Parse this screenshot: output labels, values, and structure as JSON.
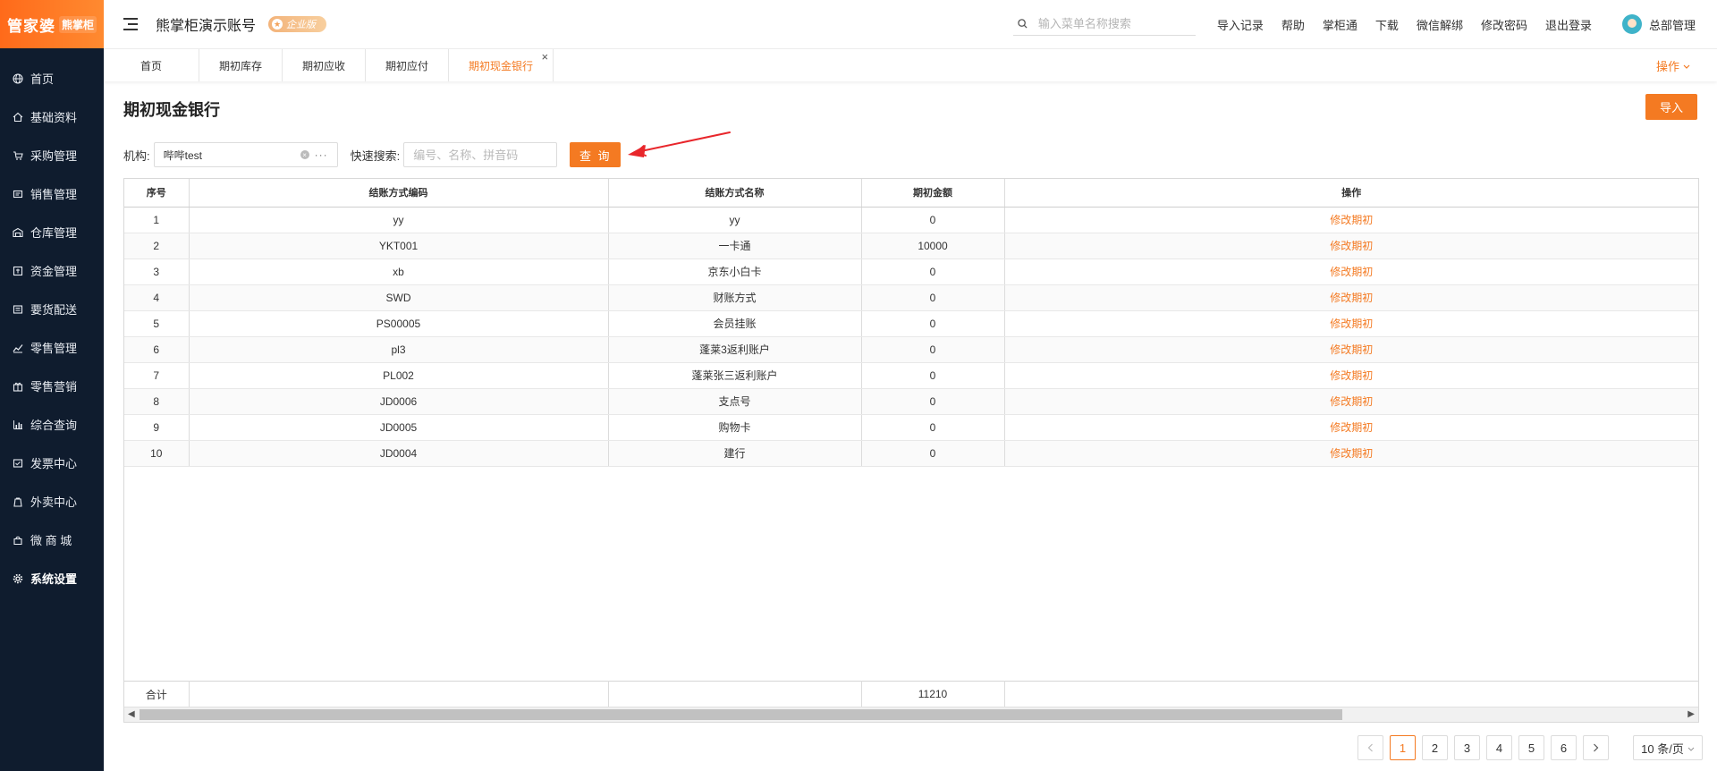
{
  "logo": {
    "brand": "管家婆",
    "product": "熊掌柜"
  },
  "sidebar": {
    "items": [
      {
        "label": "首页",
        "icon": "globe-icon"
      },
      {
        "label": "基础资料",
        "icon": "home-icon"
      },
      {
        "label": "采购管理",
        "icon": "cart-icon"
      },
      {
        "label": "销售管理",
        "icon": "sales-icon"
      },
      {
        "label": "仓库管理",
        "icon": "warehouse-icon"
      },
      {
        "label": "资金管理",
        "icon": "finance-icon"
      },
      {
        "label": "要货配送",
        "icon": "delivery-icon"
      },
      {
        "label": "零售管理",
        "icon": "retail-icon"
      },
      {
        "label": "零售营销",
        "icon": "gift-icon"
      },
      {
        "label": "综合查询",
        "icon": "chart-icon"
      },
      {
        "label": "发票中心",
        "icon": "invoice-icon"
      },
      {
        "label": "外卖中心",
        "icon": "takeout-icon"
      },
      {
        "label": "微 商 城",
        "icon": "shop-icon"
      },
      {
        "label": "系统设置",
        "icon": "gear-icon"
      }
    ],
    "active_index": 13
  },
  "header": {
    "account_title": "熊掌柜演示账号",
    "edition_badge": "企业版",
    "search_placeholder": "输入菜单名称搜索",
    "links": [
      "导入记录",
      "帮助",
      "掌柜通",
      "下载",
      "微信解绑",
      "修改密码",
      "退出登录"
    ],
    "user_name": "总部管理"
  },
  "tabs": {
    "items": [
      "首页",
      "期初库存",
      "期初应收",
      "期初应付",
      "期初现金银行"
    ],
    "active_index": 4,
    "operations_label": "操作"
  },
  "page": {
    "title": "期初现金银行",
    "import_button": "导入",
    "org_label": "机构:",
    "org_value": "哔哔test",
    "quick_search_label": "快速搜索:",
    "quick_search_placeholder": "编号、名称、拼音码",
    "query_button": "查 询"
  },
  "table": {
    "columns": [
      "序号",
      "结账方式编码",
      "结账方式名称",
      "期初金额",
      "操作"
    ],
    "rows": [
      {
        "no": "1",
        "code": "yy",
        "name": "yy",
        "amount": "0",
        "action": "修改期初"
      },
      {
        "no": "2",
        "code": "YKT001",
        "name": "一卡通",
        "amount": "10000",
        "action": "修改期初"
      },
      {
        "no": "3",
        "code": "xb",
        "name": "京东小白卡",
        "amount": "0",
        "action": "修改期初"
      },
      {
        "no": "4",
        "code": "SWD",
        "name": "财账方式",
        "amount": "0",
        "action": "修改期初"
      },
      {
        "no": "5",
        "code": "PS00005",
        "name": "会员挂账",
        "amount": "0",
        "action": "修改期初"
      },
      {
        "no": "6",
        "code": "pl3",
        "name": "蓬莱3返利账户",
        "amount": "0",
        "action": "修改期初"
      },
      {
        "no": "7",
        "code": "PL002",
        "name": "蓬莱张三返利账户",
        "amount": "0",
        "action": "修改期初"
      },
      {
        "no": "8",
        "code": "JD0006",
        "name": "支点号",
        "amount": "0",
        "action": "修改期初"
      },
      {
        "no": "9",
        "code": "JD0005",
        "name": "购物卡",
        "amount": "0",
        "action": "修改期初"
      },
      {
        "no": "10",
        "code": "JD0004",
        "name": "建行",
        "amount": "0",
        "action": "修改期初"
      }
    ],
    "total_label": "合计",
    "total_amount": "11210"
  },
  "pagination": {
    "pages": [
      "1",
      "2",
      "3",
      "4",
      "5",
      "6"
    ],
    "current": "1",
    "page_size": "10 条/页"
  },
  "colors": {
    "accent": "#f47a22",
    "sidebar_bg": "#0f1c2e"
  }
}
